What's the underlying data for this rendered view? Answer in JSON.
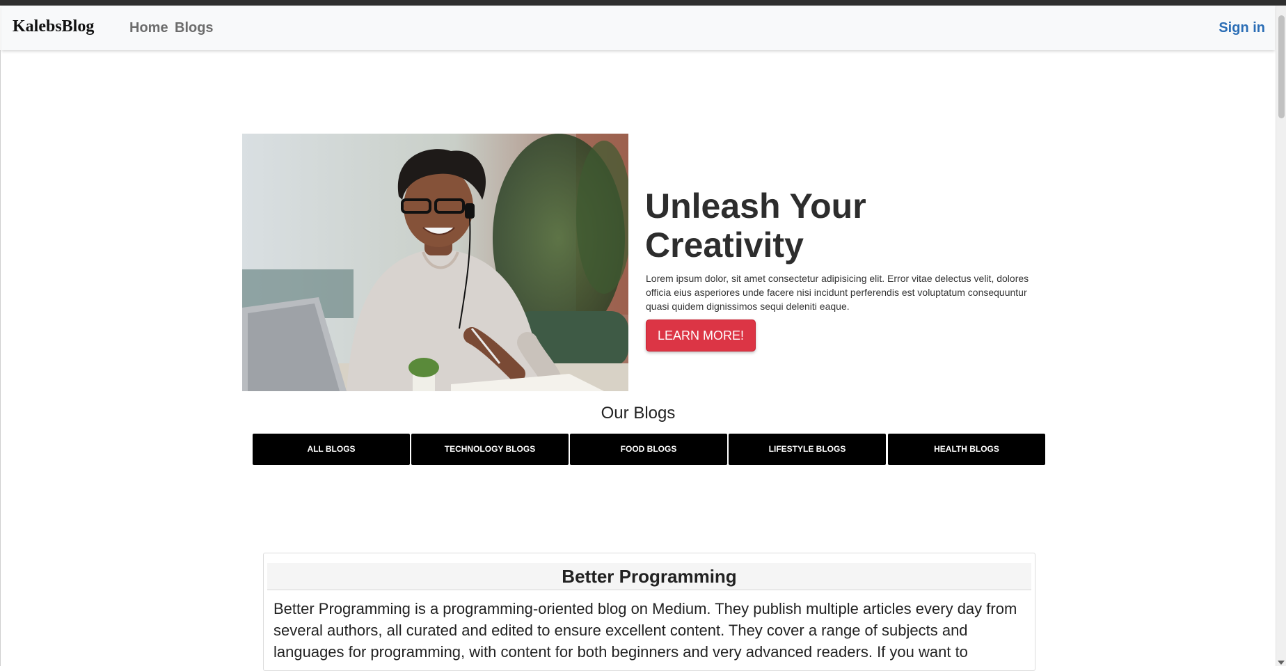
{
  "nav": {
    "brand": "KalebsBlog",
    "links": [
      "Home",
      "Blogs"
    ],
    "signin": "Sign in"
  },
  "hero": {
    "image_alt": "woman-writing-with-headphones",
    "title": "Unleash Your Creativity",
    "text": "Lorem ipsum dolor, sit amet consectetur adipisicing elit. Error vitae delectus velit, dolores officia eius asperiores unde facere nisi incidunt perferendis est voluptatum consequuntur quasi quidem dignissimos sequi deleniti eaque.",
    "button": "LEARN MORE!"
  },
  "blogs_section": {
    "title": "Our Blogs",
    "categories": [
      "ALL BLOGS",
      "TECHNOLOGY BLOGS",
      "FOOD BLOGS",
      "LIFESTYLE BLOGS",
      "HEALTH BLOGS"
    ]
  },
  "card": {
    "title": "Better Programming",
    "body": "Better Programming is a programming-oriented blog on Medium. They publish multiple articles every day from several authors, all curated and edited to ensure excellent content. They cover a range of subjects and languages for programming, with content for both beginners and very advanced readers. If you want to"
  },
  "colors": {
    "accent_button": "#dc3545",
    "link": "#2a6db5",
    "category_bg": "#000000"
  },
  "icons": [
    "scroll-down-arrow-icon"
  ]
}
